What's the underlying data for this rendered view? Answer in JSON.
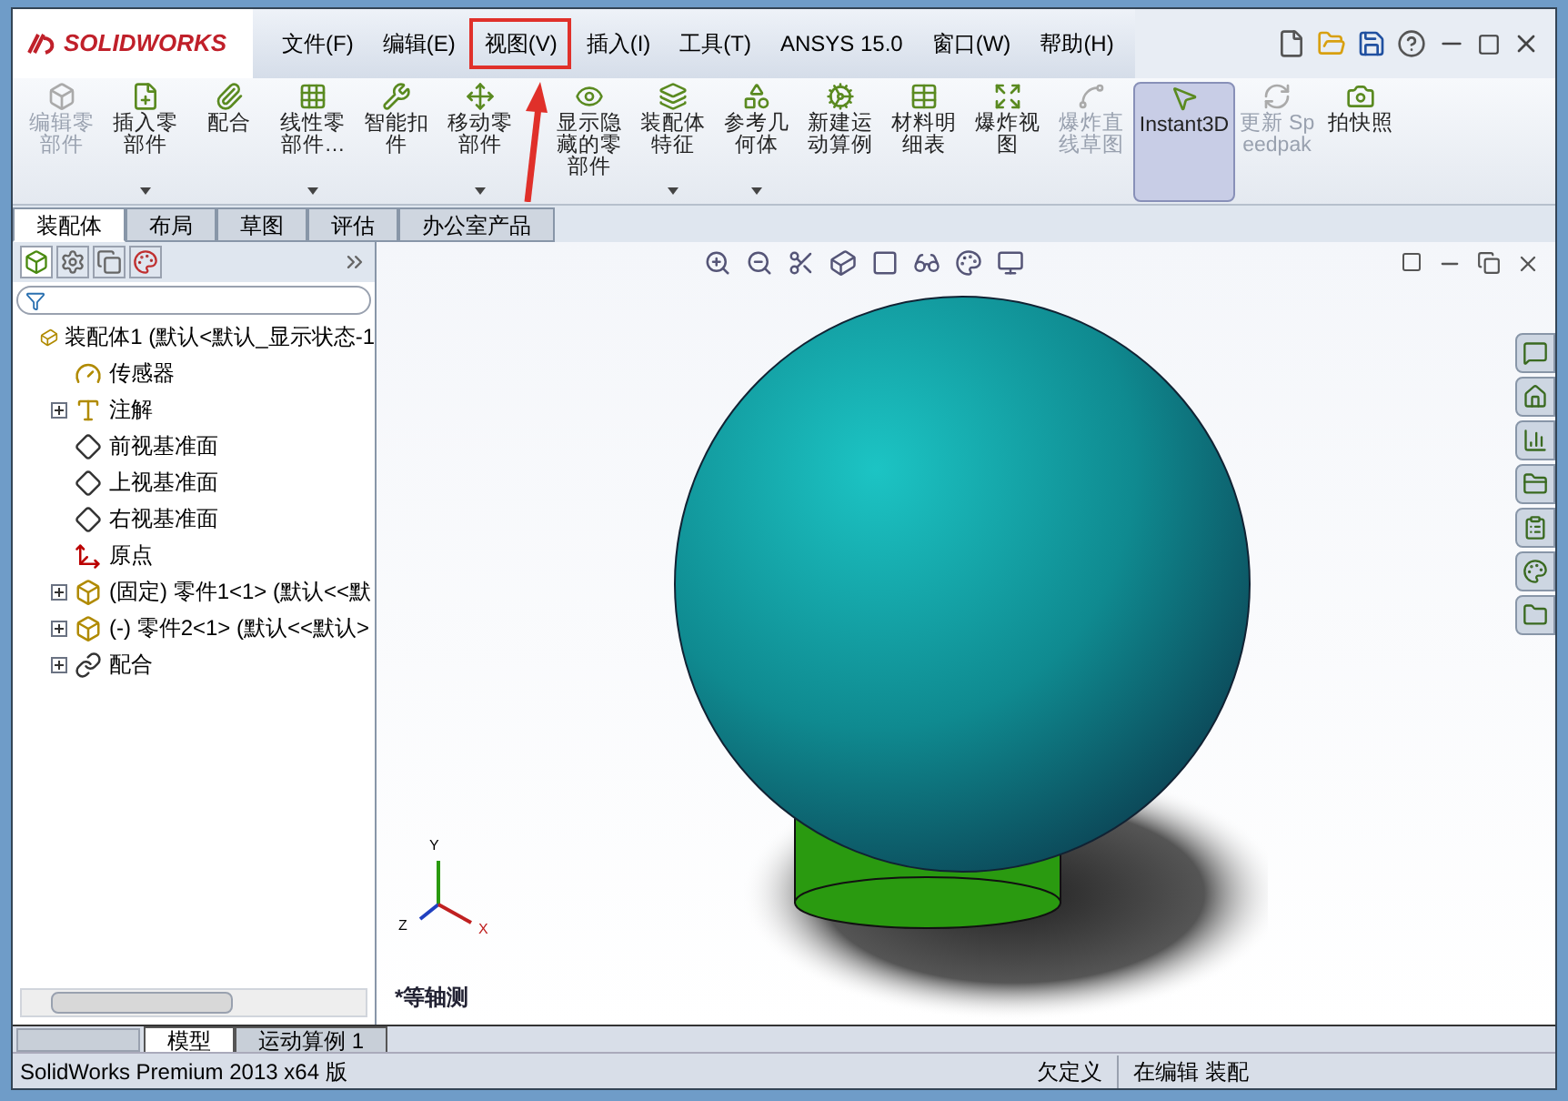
{
  "app": {
    "logo": "SOLIDWORKS"
  },
  "menu": [
    {
      "label": "文件(F)",
      "annotated": false
    },
    {
      "label": "编辑(E)",
      "annotated": false
    },
    {
      "label": "视图(V)",
      "annotated": true
    },
    {
      "label": "插入(I)",
      "annotated": false
    },
    {
      "label": "工具(T)",
      "annotated": false
    },
    {
      "label": "ANSYS 15.0",
      "annotated": false
    },
    {
      "label": "窗口(W)",
      "annotated": false
    },
    {
      "label": "帮助(H)",
      "annotated": false
    }
  ],
  "ribbon": [
    {
      "label": "编辑零部件",
      "disabled": true,
      "dropdown": false,
      "selected": false
    },
    {
      "label": "插入零部件",
      "disabled": false,
      "dropdown": true,
      "selected": false
    },
    {
      "label": "配合",
      "disabled": false,
      "dropdown": false,
      "selected": false
    },
    {
      "label": "线性零部件…",
      "disabled": false,
      "dropdown": true,
      "selected": false
    },
    {
      "label": "智能扣件",
      "disabled": false,
      "dropdown": false,
      "selected": false
    },
    {
      "label": "移动零部件",
      "disabled": false,
      "dropdown": true,
      "selected": false
    },
    {
      "label": "显示隐藏的零部件",
      "disabled": false,
      "dropdown": false,
      "selected": false
    },
    {
      "label": "装配体特征",
      "disabled": false,
      "dropdown": true,
      "selected": false
    },
    {
      "label": "参考几何体",
      "disabled": false,
      "dropdown": true,
      "selected": false
    },
    {
      "label": "新建运动算例",
      "disabled": false,
      "dropdown": false,
      "selected": false
    },
    {
      "label": "材料明细表",
      "disabled": false,
      "dropdown": false,
      "selected": false
    },
    {
      "label": "爆炸视图",
      "disabled": false,
      "dropdown": false,
      "selected": false
    },
    {
      "label": "爆炸直线草图",
      "disabled": true,
      "dropdown": false,
      "selected": false
    },
    {
      "label": "Instant3D",
      "disabled": false,
      "dropdown": false,
      "selected": true
    },
    {
      "label": "更新 Speedpak",
      "disabled": true,
      "dropdown": false,
      "selected": false
    },
    {
      "label": "拍快照",
      "disabled": false,
      "dropdown": false,
      "selected": false
    }
  ],
  "command_tabs": [
    {
      "label": "装配体",
      "selected": true
    },
    {
      "label": "布局",
      "selected": false
    },
    {
      "label": "草图",
      "selected": false
    },
    {
      "label": "评估",
      "selected": false
    },
    {
      "label": "办公室产品",
      "selected": false
    }
  ],
  "tree": {
    "label": "装配体1  (默认<默认_显示状态-1",
    "kind": "assembly",
    "children": [
      {
        "label": "传感器",
        "kind": "sensor"
      },
      {
        "label": "注解",
        "kind": "annotation",
        "expanded": false
      },
      {
        "label": "前视基准面",
        "kind": "plane"
      },
      {
        "label": "上视基准面",
        "kind": "plane"
      },
      {
        "label": "右视基准面",
        "kind": "plane"
      },
      {
        "label": "原点",
        "kind": "origin"
      },
      {
        "label": "(固定) 零件1<1> (默认<<默",
        "kind": "part",
        "expanded": false
      },
      {
        "label": "(-) 零件2<1> (默认<<默认>",
        "kind": "part",
        "expanded": false
      },
      {
        "label": "配合",
        "kind": "mates",
        "expanded": false
      }
    ]
  },
  "viewport": {
    "axes": [
      "Y",
      "Z",
      "X"
    ],
    "view_name": "*等轴测"
  },
  "bottom_tabs": [
    {
      "label": "模型",
      "selected": true
    },
    {
      "label": "运动算例 1",
      "selected": false
    }
  ],
  "status_bar": [
    "SolidWorks Premium 2013 x64 版",
    "欠定义",
    "在编辑 装配"
  ]
}
